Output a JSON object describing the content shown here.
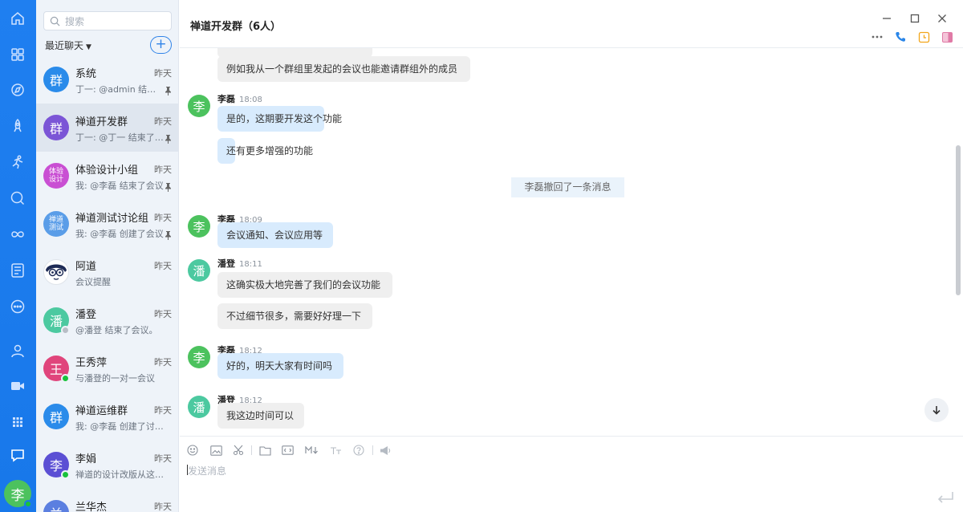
{
  "sidebar": {
    "search_placeholder": "搜索",
    "recent_label": "最近聊天",
    "add_label": "+",
    "chats": [
      {
        "name": "系统",
        "time": "昨天",
        "preview": "丁一: @admin 结束了会议",
        "avatar_text": "群",
        "avatar_color": "#2a8bea",
        "pinned": true,
        "active": false
      },
      {
        "name": "禅道开发群",
        "time": "昨天",
        "preview": "丁一: @丁一 结束了会议",
        "avatar_text": "群",
        "avatar_color": "#7b55d6",
        "pinned": true,
        "active": true
      },
      {
        "name": "体验设计小组",
        "time": "昨天",
        "preview": "我: @李磊 结束了会议",
        "avatar_text": "体验设计",
        "avatar_color": "#c94fd3",
        "pinned": true,
        "active": false
      },
      {
        "name": "禅道测试讨论组",
        "time": "昨天",
        "preview": "我: @李磊 创建了会议",
        "avatar_text": "禅道测试",
        "avatar_color": "#5a9de8",
        "pinned": true,
        "active": false
      },
      {
        "name": "阿道",
        "time": "昨天",
        "preview": "会议提醒",
        "avatar_text": "",
        "avatar_color": "#ffffff",
        "pinned": false,
        "active": false
      },
      {
        "name": "潘登",
        "time": "昨天",
        "preview": "@潘登 结束了会议。",
        "avatar_text": "潘",
        "avatar_color": "#4cc9a0",
        "pinned": false,
        "active": false,
        "status": "#b8bec6"
      },
      {
        "name": "王秀萍",
        "time": "昨天",
        "preview": "与潘登的一对一会议",
        "avatar_text": "王",
        "avatar_color": "#e0457c",
        "pinned": false,
        "active": false,
        "status": "#19c23b"
      },
      {
        "name": "禅道运维群",
        "time": "昨天",
        "preview": "我: @李磊 创建了讨论组",
        "avatar_text": "群",
        "avatar_color": "#2a8bea",
        "pinned": false,
        "active": false
      },
      {
        "name": "李娟",
        "time": "昨天",
        "preview": "禅道的设计改版从这里开始",
        "avatar_text": "李",
        "avatar_color": "#5b4fd4",
        "pinned": false,
        "active": false,
        "status": "#19c23b"
      },
      {
        "name": "兰华杰",
        "time": "昨天",
        "preview": "",
        "avatar_text": "兰",
        "avatar_color": "#5b7fe0",
        "pinned": false,
        "active": false
      }
    ]
  },
  "nav": {
    "user_avatar_text": "李",
    "icons": [
      "home-icon",
      "apps-icon",
      "discover-icon",
      "rocket-icon",
      "run-icon",
      "search-circle-icon",
      "infinity-icon",
      "list-icon",
      "more-circle-icon",
      "contacts-icon",
      "video-icon",
      "grid-icon",
      "chat-icon"
    ]
  },
  "chat": {
    "title": "禅道开发群（6人）",
    "messages": [
      {
        "type": "bubble",
        "style": "gray",
        "text": "例如我从一个群组里发起的会议也能邀请群组外的成员"
      },
      {
        "type": "header",
        "sender": "李磊",
        "time": "18:08",
        "avatar_text": "李",
        "avatar_color": "#4cc25e"
      },
      {
        "type": "bubble",
        "style": "blue",
        "text": "是的，这期要开发这个功能"
      },
      {
        "type": "bubble",
        "style": "blue",
        "text": "还有更多增强的功能"
      },
      {
        "type": "system",
        "text": "李磊撤回了一条消息"
      },
      {
        "type": "header",
        "sender": "李磊",
        "time": "18:09",
        "avatar_text": "李",
        "avatar_color": "#4cc25e"
      },
      {
        "type": "bubble",
        "style": "blue",
        "text": "会议通知、会议应用等"
      },
      {
        "type": "header",
        "sender": "潘登",
        "time": "18:11",
        "avatar_text": "潘",
        "avatar_color": "#4cc9a0"
      },
      {
        "type": "bubble",
        "style": "gray",
        "text": "这确实极大地完善了我们的会议功能"
      },
      {
        "type": "bubble",
        "style": "gray",
        "text": "不过细节很多，需要好好理一下"
      },
      {
        "type": "header",
        "sender": "李磊",
        "time": "18:12",
        "avatar_text": "李",
        "avatar_color": "#4cc25e"
      },
      {
        "type": "bubble",
        "style": "blue",
        "text": "好的，明天大家有时间吗"
      },
      {
        "type": "header",
        "sender": "潘登",
        "time": "18:12",
        "avatar_text": "潘",
        "avatar_color": "#4cc9a0"
      },
      {
        "type": "bubble",
        "style": "gray",
        "text": "我这边时间可以"
      }
    ]
  },
  "editor": {
    "placeholder": "发送消息",
    "tools": [
      "emoji-icon",
      "image-icon",
      "scissors-icon",
      "folder-icon",
      "code-icon",
      "markdown-icon",
      "text-size-icon",
      "help-icon",
      "broadcast-icon"
    ]
  },
  "colors": {
    "nav_blue": "#1a7ae8",
    "accent": "#2f83e8",
    "bubble_blue": "#d8ebfd",
    "bubble_gray": "#efefef"
  }
}
